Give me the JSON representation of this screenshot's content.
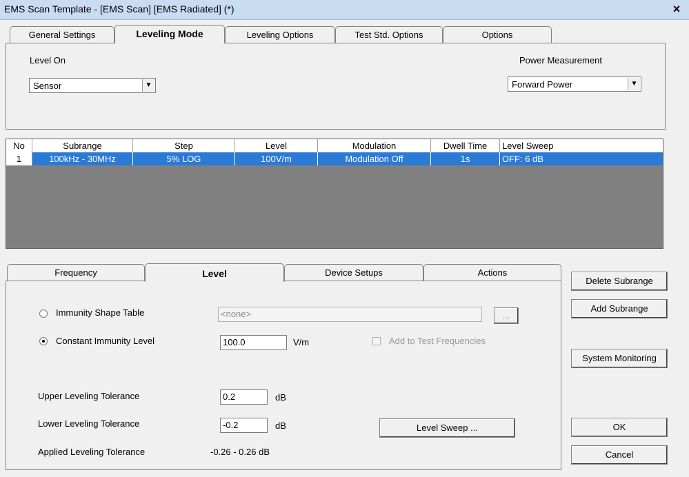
{
  "window": {
    "title": "EMS Scan Template - [EMS Scan] [EMS Radiated] (*)",
    "close_glyph": "×"
  },
  "top_tabs": [
    {
      "label": "General Settings"
    },
    {
      "label": "Leveling Mode"
    },
    {
      "label": "Leveling Options"
    },
    {
      "label": "Test Std. Options"
    },
    {
      "label": "Options"
    }
  ],
  "leveling_mode": {
    "level_on_label": "Level On",
    "level_on_value": "Sensor",
    "power_measurement_label": "Power Measurement",
    "power_measurement_value": "Forward Power"
  },
  "grid": {
    "columns": [
      "No",
      "Subrange",
      "Step",
      "Level",
      "Modulation",
      "Dwell Time",
      "Level Sweep"
    ],
    "rows": [
      [
        "1",
        "100kHz - 30MHz",
        "5% LOG",
        "100V/m",
        "Modulation Off",
        "1s",
        "OFF: 6 dB"
      ]
    ]
  },
  "bottom_tabs": [
    {
      "label": "Frequency"
    },
    {
      "label": "Level"
    },
    {
      "label": "Device Setups"
    },
    {
      "label": "Actions"
    }
  ],
  "level_tab": {
    "immunity_shape_label": "Immunity Shape Table",
    "immunity_shape_value": "<none>",
    "browse_label": "...",
    "constant_immunity_label": "Constant Immunity Level",
    "constant_immunity_value": "100.0",
    "constant_immunity_unit": "V/m",
    "add_to_test_label": "Add to Test Frequencies",
    "upper_tol_label": "Upper Leveling Tolerance",
    "upper_tol_value": "0.2",
    "upper_tol_unit": "dB",
    "lower_tol_label": "Lower Leveling Tolerance",
    "lower_tol_value": "-0.2",
    "lower_tol_unit": "dB",
    "applied_tol_label": "Applied Leveling Tolerance",
    "applied_tol_value": "-0.26 - 0.26 dB",
    "level_sweep_button": "Level Sweep ..."
  },
  "side_buttons": {
    "delete_subrange": "Delete Subrange",
    "add_subrange": "Add Subrange",
    "system_monitoring": "System Monitoring",
    "ok": "OK",
    "cancel": "Cancel"
  },
  "colors": {
    "selection": "#2a7ad6",
    "titlebar": "#c9dcf2",
    "grid_empty": "#808080"
  }
}
